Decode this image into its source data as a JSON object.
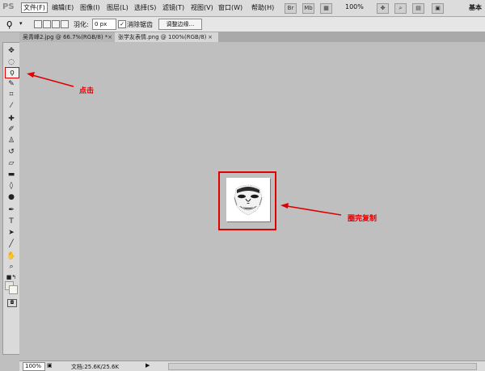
{
  "app": {
    "logo": "PS",
    "workspace": "基本"
  },
  "menu": {
    "items": [
      "文件(F)",
      "编辑(E)",
      "图像(I)",
      "图层(L)",
      "选择(S)",
      "滤镜(T)",
      "视图(V)",
      "窗口(W)",
      "帮助(H)"
    ],
    "zoom": "100%",
    "br_label": "Br",
    "mb_label": "Mb"
  },
  "options": {
    "feather_label": "羽化:",
    "feather_value": "0 px",
    "antialias_label": "消除锯齿",
    "antialias_checked": "✓",
    "refine_edge": "调整边缘..."
  },
  "tabs": [
    {
      "label": "吴青峰2.jpg @ 66.7%(RGB/8) *",
      "close": "×"
    },
    {
      "label": "张学友表情.png @ 100%(RGB/8)",
      "close": "×"
    }
  ],
  "annotations": {
    "click": "点击",
    "copy": "圈完复制"
  },
  "status": {
    "zoom": "100%",
    "doc": "文档:25.6K/25.6K",
    "arrow": "▶"
  },
  "colors": {
    "highlight": "#e00000",
    "canvas_bg": "#bfbfbf"
  }
}
